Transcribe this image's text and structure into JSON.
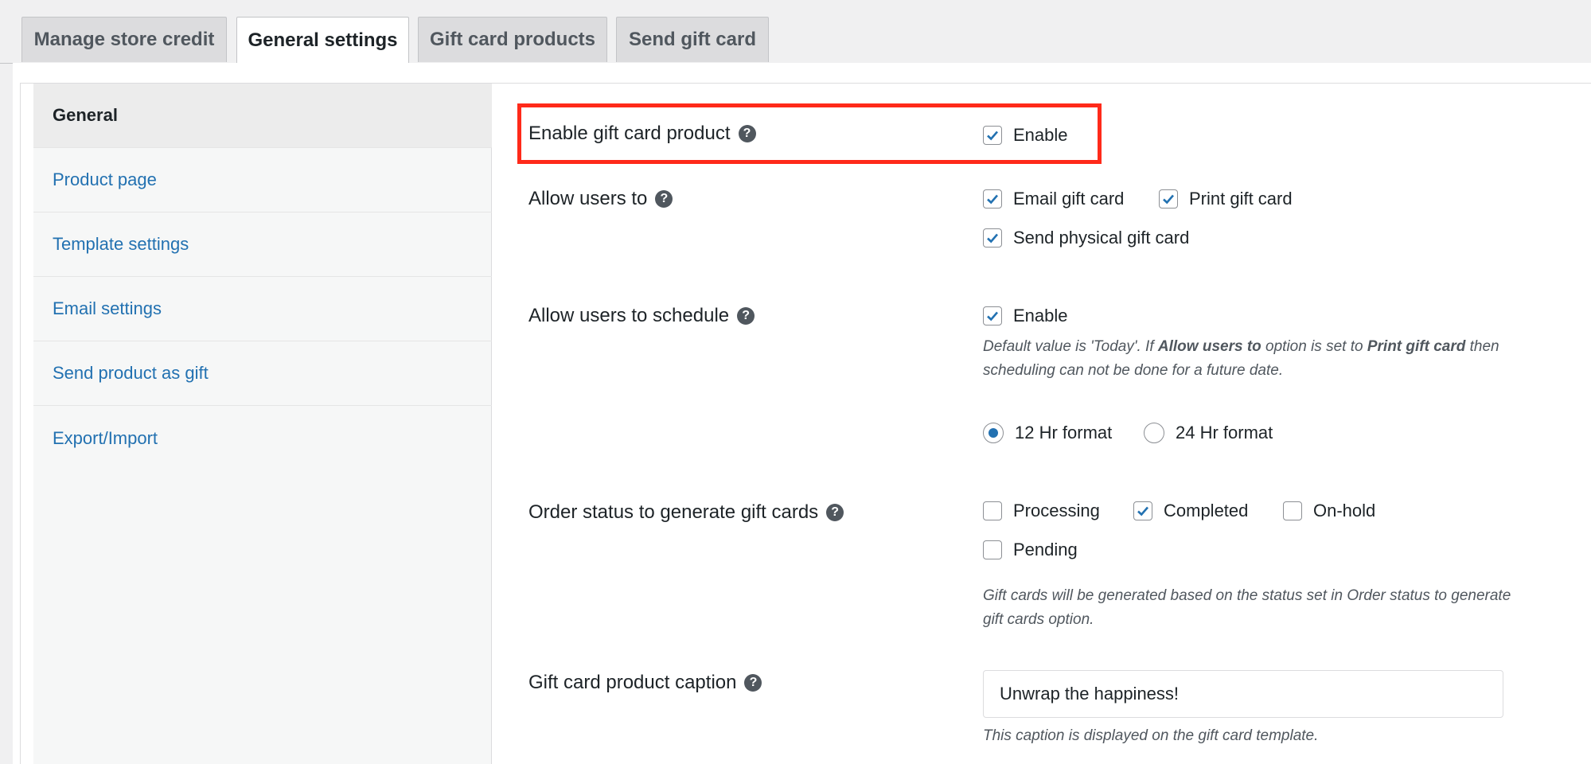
{
  "tabs": [
    {
      "label": "Manage store credit"
    },
    {
      "label": "General settings"
    },
    {
      "label": "Gift card products"
    },
    {
      "label": "Send gift card"
    }
  ],
  "sidebar": {
    "items": [
      {
        "label": "General"
      },
      {
        "label": "Product page"
      },
      {
        "label": "Template settings"
      },
      {
        "label": "Email settings"
      },
      {
        "label": "Send product as gift"
      },
      {
        "label": "Export/Import"
      }
    ]
  },
  "settings": {
    "enable_gift_card": {
      "label": "Enable gift card product",
      "option": "Enable",
      "checked": true
    },
    "allow_users": {
      "label": "Allow users to",
      "options": [
        {
          "label": "Email gift card",
          "checked": true
        },
        {
          "label": "Print gift card",
          "checked": true
        },
        {
          "label": "Send physical gift card",
          "checked": true
        }
      ]
    },
    "schedule": {
      "label": "Allow users to schedule",
      "option": "Enable",
      "checked": true,
      "desc_1": "Default value is 'Today'. If ",
      "desc_b1": "Allow users to",
      "desc_2": " option is set to ",
      "desc_b2": "Print gift card",
      "desc_3": " then scheduling can not be done for a future date.",
      "formats": [
        {
          "label": "12 Hr format",
          "selected": true
        },
        {
          "label": "24 Hr format",
          "selected": false
        }
      ]
    },
    "order_status": {
      "label": "Order status to generate gift cards",
      "options": [
        {
          "label": "Processing",
          "checked": false
        },
        {
          "label": "Completed",
          "checked": true
        },
        {
          "label": "On-hold",
          "checked": false
        },
        {
          "label": "Pending",
          "checked": false
        }
      ],
      "desc": "Gift cards will be generated based on the status set in Order status to generate gift cards option."
    },
    "caption": {
      "label": "Gift card product caption",
      "value": "Unwrap the happiness!",
      "desc": "This caption is displayed on the gift card template."
    }
  },
  "help_glyph": "?",
  "colors": {
    "accent": "#2271b1",
    "highlight": "#ff2a1a"
  }
}
